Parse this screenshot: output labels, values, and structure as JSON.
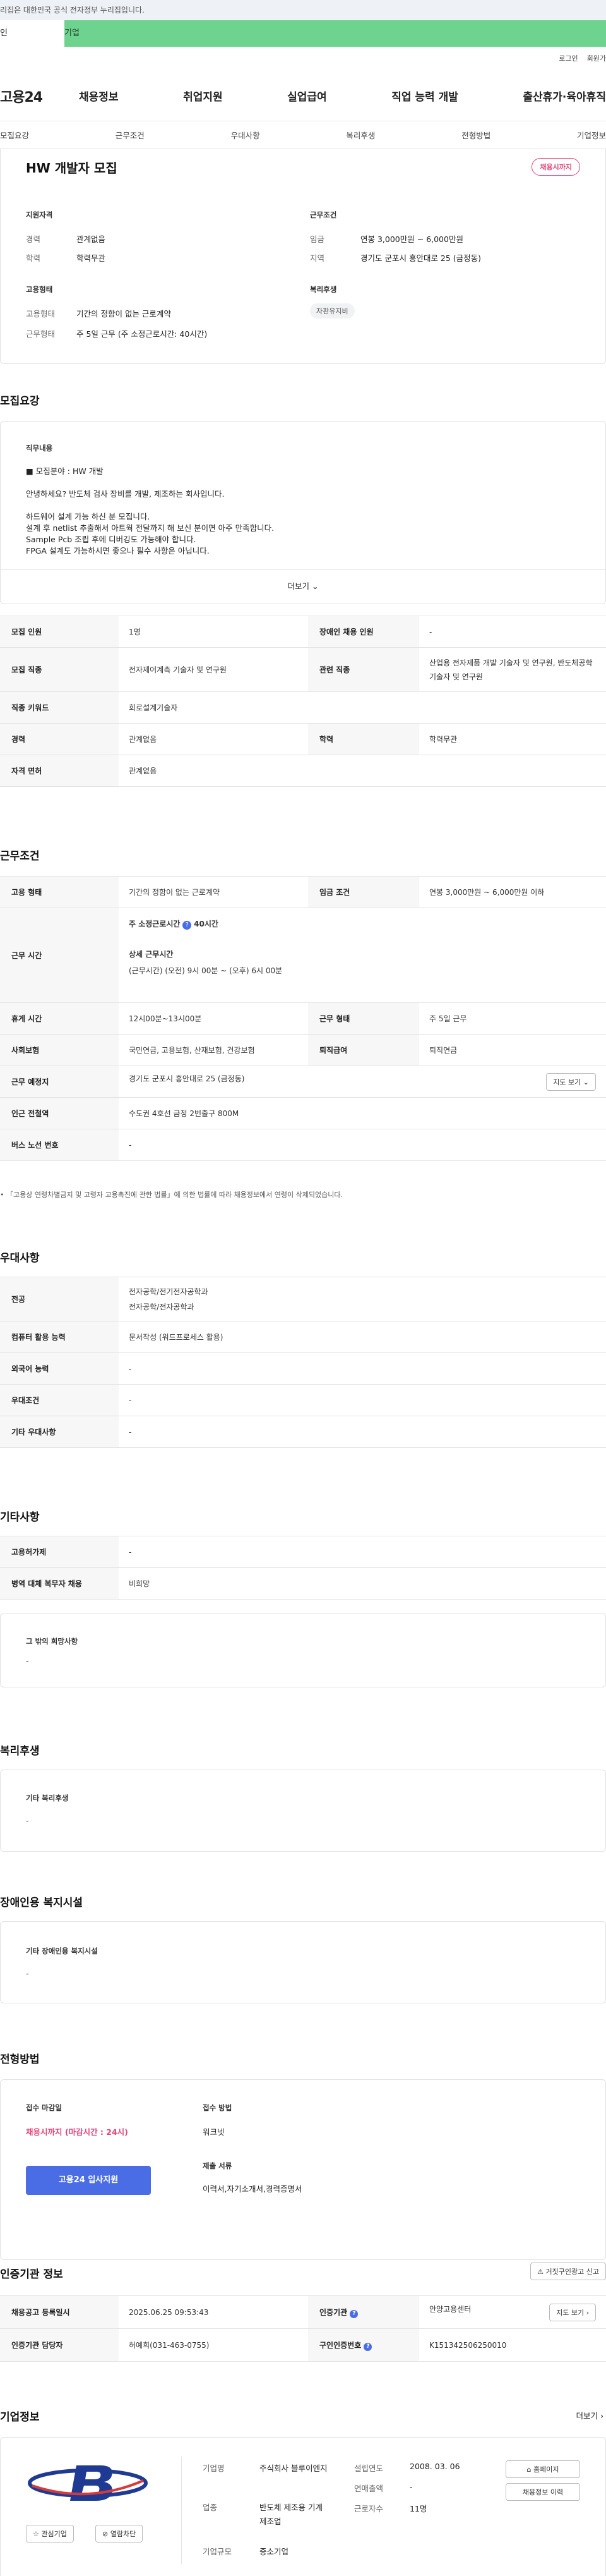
{
  "gov_banner": "이 누리집은 대한민국 공식 전자정부 누리집입니다.",
  "gov_banner_shown": "리집은 대한민국 공식 전자정부 누리집입니다.",
  "service_bar": {
    "left": "인",
    "right": "기업"
  },
  "util": {
    "login": "로그인",
    "join": "회원가"
  },
  "logo": "고용24",
  "gnb": [
    "채용정보",
    "취업지원",
    "실업급여",
    "직업 능력 개발",
    "출산휴가·육아휴직"
  ],
  "tabs": [
    "모집요강",
    "근무조건",
    "우대사항",
    "복리후생",
    "전형방법",
    "기업정보"
  ],
  "job": {
    "title": "HW 개발자 모집",
    "status": "채용시까지",
    "qual_title": "지원자격",
    "career_lbl": "경력",
    "career": "관계없음",
    "edu_lbl": "학력",
    "edu": "학력무관",
    "cond_title": "근무조건",
    "wage_lbl": "임금",
    "wage": "연봉 3,000만원 ~ 6,000만원",
    "region_lbl": "지역",
    "region": "경기도 군포시 흥안대로 25 (금정동)",
    "emp_title": "고용형태",
    "emptype_lbl": "고용형태",
    "emptype": "기간의 정함이 없는 근로계약",
    "worktype_lbl": "근무형태",
    "worktype": "주 5일 근무 (주 소정근로시간: 40시간)",
    "welfare_title": "복리후생",
    "welfare_chip": "자판유지비"
  },
  "recruit": {
    "heading": "모집요강",
    "duty_title": "직무내용",
    "duty_field": "모집분야 : HW 개발",
    "lines": [
      "안녕하세요? 반도체 검사 장비를 개발, 제조하는 회사입니다.",
      "하드웨어 설계 가능 하신 분 모집니다.",
      "설계 후 netlist 추출해서 아트웍 전달까지 해 보신 분이면 아주 만족합니다.",
      "Sample Pcb 조립 후에 디버깅도 가능해야 합니다.",
      "FPGA 설계도 가능하시면 좋으나 필수 사항은 아닙니다."
    ],
    "more": "더보기",
    "rows": [
      [
        "모집 인원",
        "1명",
        "장애인 채용 인원",
        "-"
      ],
      [
        "모집 직종",
        "전자제어계측 기술자 및 연구원",
        "관련 직종",
        "산업용 전자제품 개발 기술자 및 연구원, 반도체공학 기술자 및 연구원"
      ],
      [
        "직종 키워드",
        "회로설계기술자",
        "",
        ""
      ],
      [
        "경력",
        "관계없음",
        "학력",
        "학력무관"
      ],
      [
        "자격 면허",
        "관계없음",
        "",
        ""
      ]
    ]
  },
  "work": {
    "heading": "근무조건",
    "emp_lbl": "고용 형태",
    "emp": "기간의 정함이 없는 근로계약",
    "wage_lbl": "임금 조건",
    "wage": "연봉 3,000만원 ~ 6,000만원 이하",
    "hours_lbl": "근무 시간",
    "std_hours": "주 소정근로시간",
    "std_hours_val": "40시간",
    "detail_lbl": "상세 근무시간",
    "detail": "(근무시간) (오전) 9시 00분 ~ (오후) 6시 00분",
    "rest_lbl": "휴게 시간",
    "rest": "12시00분~13시00분",
    "form_lbl": "근무 형태",
    "form": "주 5일 근무",
    "ins_lbl": "사회보험",
    "ins": "국민연금, 고용보험, 산재보험, 건강보험",
    "ret_lbl": "퇴직급여",
    "ret": "퇴직연금",
    "place_lbl": "근무 예정지",
    "place": "경기도 군포시 흥안대로 25 (금정동)",
    "map_btn": "지도 보기",
    "subway_lbl": "인근 전철역",
    "subway": "수도권 4호선 금정 2번출구 800M",
    "bus_lbl": "버스 노선 번호",
    "bus": "-",
    "note": "「고용상 연령차별금지 및 고령자 고용촉진에 관한 법률」에 의한 법률에 따라 채용정보에서 연령이 삭제되었습니다."
  },
  "pref": {
    "heading": "우대사항",
    "major_lbl": "전공",
    "major1": "전자공학/전기전자공학과",
    "major2": "전자공학/전자공학과",
    "pc_lbl": "컴퓨터 활용 능력",
    "pc": "문서작성 (워드프로세스 활용)",
    "lang_lbl": "외국어 능력",
    "lang": "-",
    "cond_lbl": "우대조건",
    "cond": "-",
    "etc_lbl": "기타 우대사항",
    "etc": "-"
  },
  "other": {
    "heading": "기타사항",
    "mach_lbl": "고용허가제",
    "mach": "-",
    "mil_lbl": "병역 대체 복무자 채용",
    "mil": "비희망",
    "wish_title": "그 밖의 희망사항",
    "wish": "-"
  },
  "welfare": {
    "heading": "복리후생",
    "etc_title": "기타 복리후생",
    "etc": "-"
  },
  "disab": {
    "heading": "장애인용 복지시설",
    "etc_title": "기타 장애인용 복지시설",
    "etc": "-"
  },
  "apply": {
    "heading": "전형방법",
    "deadline_lbl": "접수 마감일",
    "deadline": "채용시까지 (마감시간 : 24시)",
    "method_lbl": "접수 방법",
    "method": "워크넷",
    "docs_lbl": "제출 서류",
    "docs": "이력서,자기소개서,경력증명서",
    "apply_btn": "고용24 입사지원"
  },
  "cert": {
    "heading": "인증기관 정보",
    "report_btn": "거짓구인광고 신고",
    "reg_lbl": "채용공고 등록일시",
    "reg": "2025.06.25 09:53:43",
    "org_lbl": "인증기관",
    "org": "안양고용센터",
    "map_btn": "지도 보기",
    "mgr_lbl": "인증기관 담당자",
    "mgr": "허예희(031-463-0755)",
    "no_lbl": "구인인증번호",
    "no": "K151342506250010"
  },
  "company": {
    "heading": "기업정보",
    "more": "더보기",
    "name_lbl": "기업명",
    "name": "주식회사 블루이엔지",
    "ind_lbl": "업종",
    "ind": "반도체 제조용 기계 제조업",
    "size_lbl": "기업규모",
    "size": "중소기업",
    "est_lbl": "설립연도",
    "est": "2008. 03. 06",
    "rev_lbl": "연매출액",
    "rev": "-",
    "emp_lbl": "근로자수",
    "emp": "11명",
    "hp_btn": "홈페이지",
    "jobs_btn": "채용정보 이력",
    "fav_btn": "관심기업",
    "block_btn": "열람차단"
  },
  "colors": {
    "accent": "#4a6de5",
    "badge": "#e0457b",
    "green": "#6dd38f"
  }
}
